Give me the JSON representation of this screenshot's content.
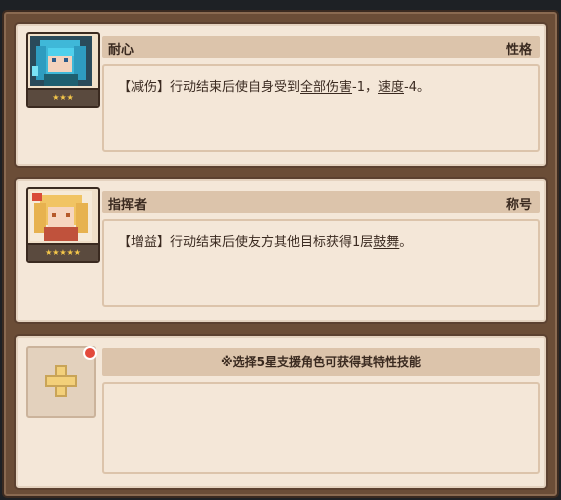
{
  "slots": [
    {
      "title": "耐心",
      "type": "性格",
      "stars": "★★★",
      "desc_prefix": "【减伤】行动结束后使自身受到",
      "desc_u1": "全部伤害",
      "desc_mid": "-1，",
      "desc_u2": "速度",
      "desc_suffix": "-4。",
      "portrait_icon": "blue-haired-character-portrait"
    },
    {
      "title": "指挥者",
      "type": "称号",
      "stars": "★★★★★",
      "desc_prefix": "【增益】行动结束后使友方其他目标获得1层",
      "desc_u1": "鼓舞",
      "desc_suffix": "。",
      "portrait_icon": "blonde-character-portrait"
    }
  ],
  "empty_slot": {
    "hint": "※选择5星支援角色可获得其特性技能",
    "add_icon": "plus-icon",
    "badge_icon": "red-dot-notification"
  },
  "colors": {
    "frame": "#6b4d37",
    "card_bg": "#f4e7d8",
    "title_bar": "#dcc4ab",
    "star": "#f7c94a",
    "badge": "#e34a3c"
  }
}
